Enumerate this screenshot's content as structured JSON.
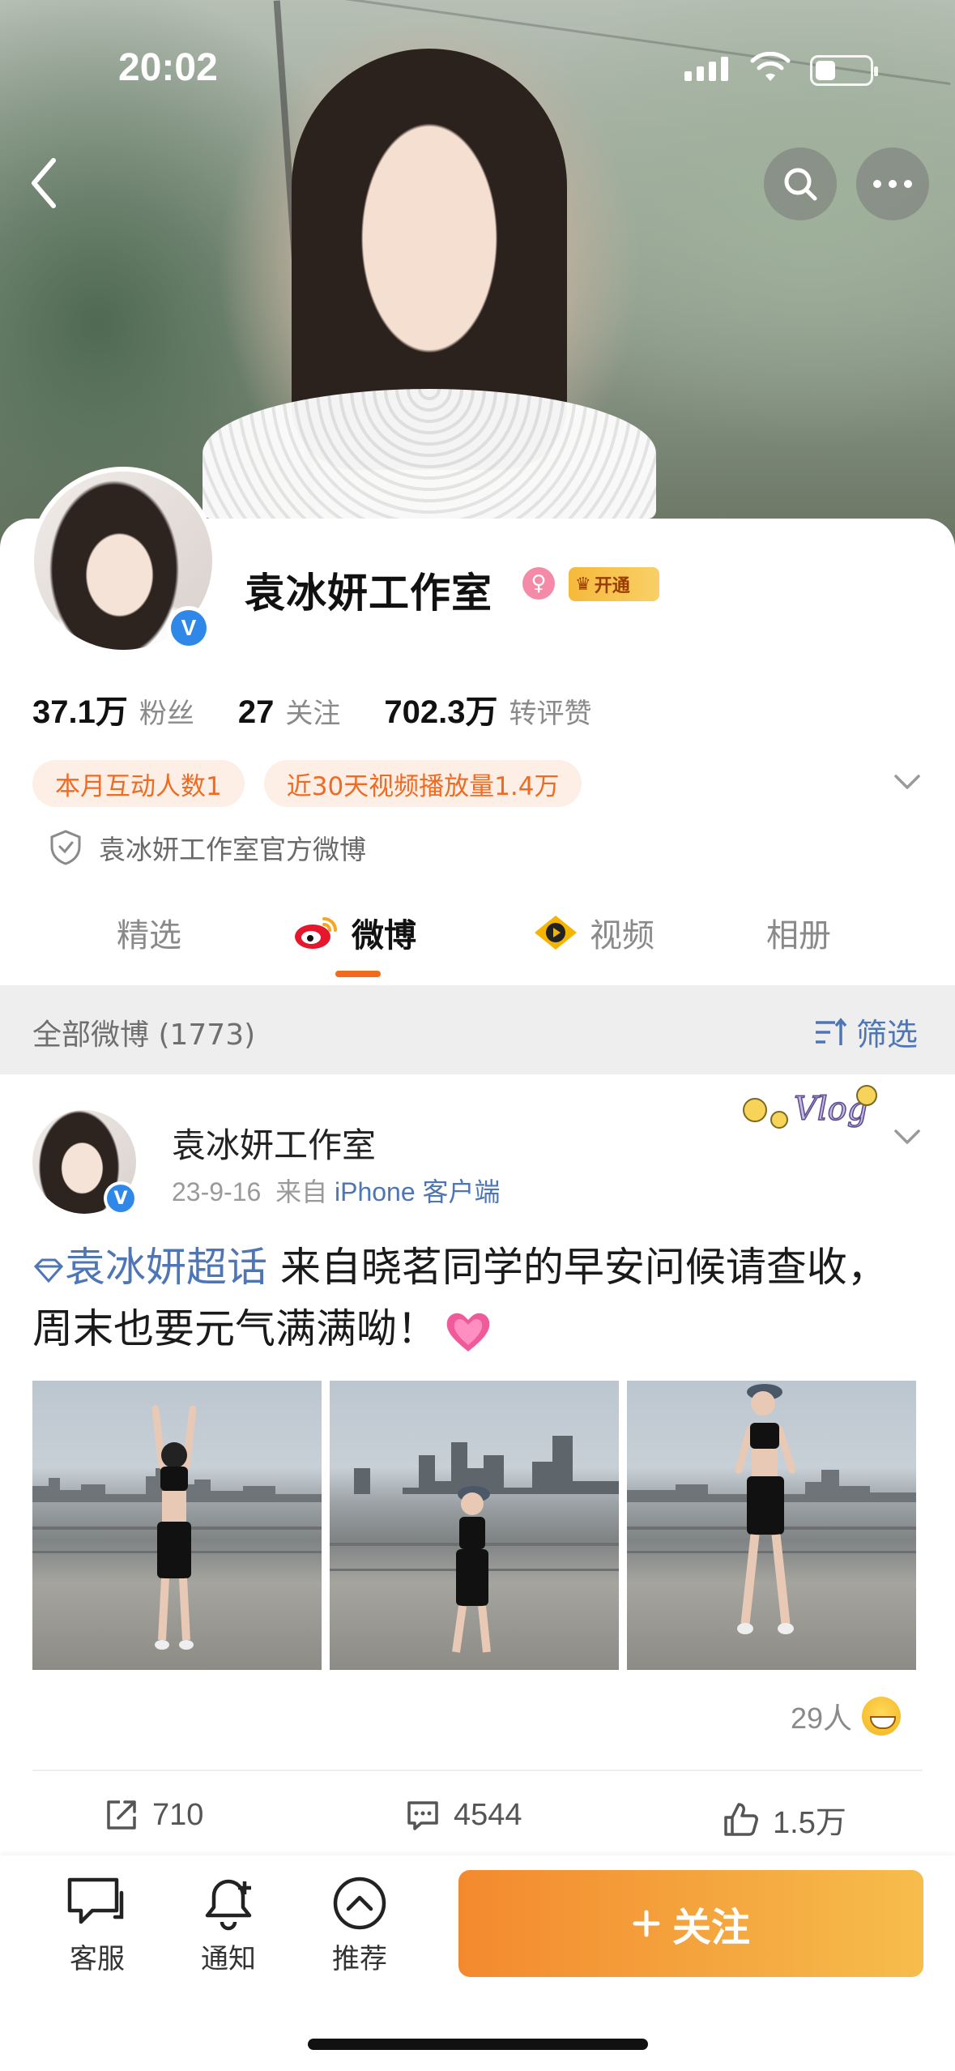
{
  "status_bar": {
    "time": "20:02"
  },
  "profile": {
    "name": "袁冰妍工作室",
    "vip_label": "开通",
    "stats": [
      {
        "value": "37.1万",
        "label": "粉丝"
      },
      {
        "value": "27",
        "label": "关注"
      },
      {
        "value": "702.3万",
        "label": "转评赞"
      }
    ],
    "pills": [
      "本月互动人数1",
      "近30天视频播放量1.4万"
    ],
    "official_text": "袁冰妍工作室官方微博"
  },
  "tabs": [
    {
      "label": "精选"
    },
    {
      "label": "微博"
    },
    {
      "label": "视频"
    },
    {
      "label": "相册"
    }
  ],
  "section": {
    "title": "全部微博 (1773)",
    "filter_label": "筛选"
  },
  "post": {
    "author": "袁冰妍工作室",
    "date": "23-9-16",
    "from_prefix": "来自",
    "source": "iPhone 客户端",
    "topic": "袁冰妍超话",
    "text": " 来自晓茗同学的早安问候请查收，周末也要元气满满呦！",
    "reaction_count": "29人",
    "actions": {
      "repost": "710",
      "comment": "4544",
      "like": "1.5万"
    }
  },
  "bottom_bar": {
    "items": [
      {
        "label": "客服"
      },
      {
        "label": "通知"
      },
      {
        "label": "推荐"
      }
    ],
    "follow_label": "关注"
  },
  "colors": {
    "accent_orange": "#f26b1d",
    "link_blue": "#4e76b7",
    "verify_blue": "#2f88e8",
    "pill_bg": "#fdeee6",
    "pill_text": "#f06b22"
  },
  "icons": [
    "back-icon",
    "search-icon",
    "more-icon",
    "verified-icon",
    "female-icon",
    "vip-crown-icon",
    "chevron-down-icon",
    "shield-icon",
    "weibo-icon",
    "video-icon",
    "filter-icon",
    "topic-icon",
    "heart-icon",
    "repost-icon",
    "comment-icon",
    "like-icon",
    "service-icon",
    "bell-icon",
    "recommend-icon",
    "plus-icon"
  ]
}
